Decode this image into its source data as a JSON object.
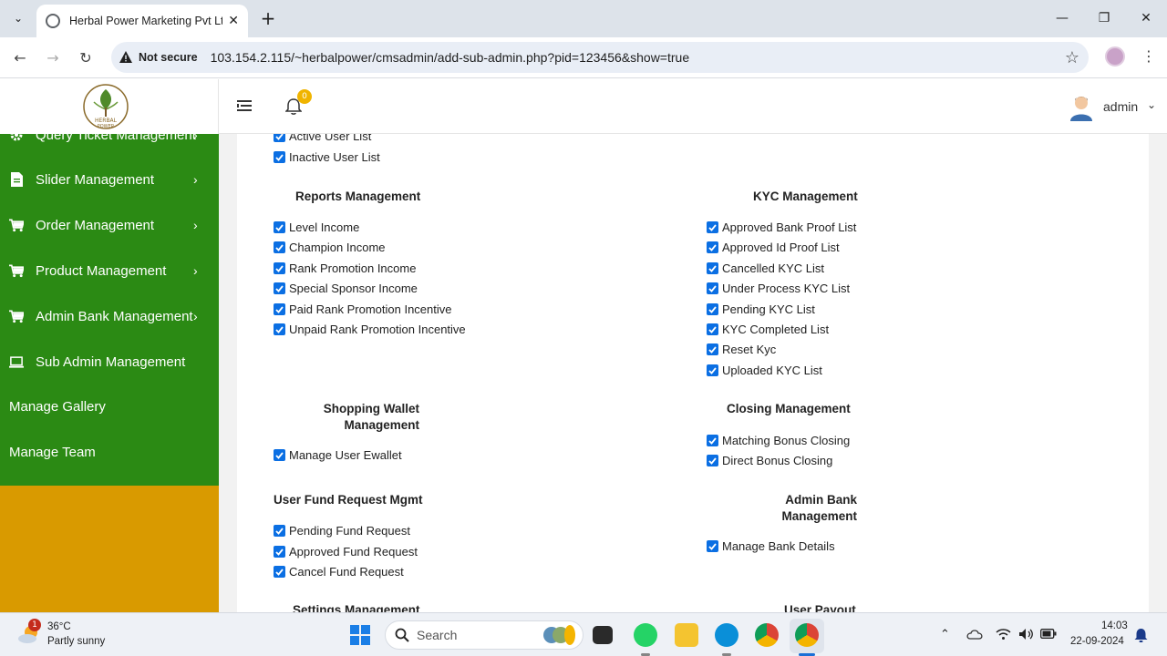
{
  "browser": {
    "tab_title": "Herbal Power Marketing Pvt Ltd",
    "security_label": "Not secure",
    "url": "103.154.2.115/~herbalpower/cmsadmin/add-sub-admin.php?pid=123456&show=true"
  },
  "header": {
    "logo_text": "HERBAL POWER",
    "notification_count": "0",
    "user_name": "admin"
  },
  "sidebar": {
    "items": [
      {
        "label": "Query Ticket Management",
        "icon": "gear-icon"
      },
      {
        "label": "Slider Management",
        "icon": "document-icon"
      },
      {
        "label": "Order Management",
        "icon": "cart-icon"
      },
      {
        "label": "Product Management",
        "icon": "cart-icon"
      },
      {
        "label": "Admin Bank Management",
        "icon": "cart-icon"
      },
      {
        "label": "Sub Admin Management",
        "icon": "laptop-icon"
      },
      {
        "label": "Manage Gallery"
      },
      {
        "label": "Manage Team"
      }
    ],
    "colors": {
      "background": "#2b8a14",
      "fill": "#d99a00"
    }
  },
  "permissions": {
    "user_partial": [
      "Active User List",
      "Inactive User List"
    ],
    "reports": {
      "title": "Reports Management",
      "items": [
        "Level Income",
        "Champion Income",
        "Rank Promotion Income",
        "Special Sponsor Income",
        "Paid Rank Promotion Incentive",
        "Unpaid Rank Promotion Incentive"
      ]
    },
    "kyc": {
      "title": "KYC Management",
      "items": [
        "Approved Bank Proof List",
        "Approved Id Proof List",
        "Cancelled KYC List",
        "Under Process KYC List",
        "Pending KYC List",
        "KYC Completed List",
        "Reset Kyc",
        "Uploaded KYC List"
      ]
    },
    "shopping_wallet": {
      "title_line1": "Shopping Wallet",
      "title_line2": "Management",
      "items": [
        "Manage User Ewallet"
      ]
    },
    "closing": {
      "title": "Closing Management",
      "items": [
        "Matching Bonus Closing",
        "Direct Bonus Closing"
      ]
    },
    "fund_request": {
      "title": "User Fund Request Mgmt",
      "items": [
        "Pending Fund Request",
        "Approved Fund Request",
        "Cancel Fund Request"
      ]
    },
    "admin_bank": {
      "title_line1": "Admin Bank",
      "title_line2": "Management",
      "items": [
        "Manage Bank Details"
      ]
    },
    "settings": {
      "title": "Settings Management"
    },
    "payout": {
      "title": "User Payout"
    }
  },
  "taskbar": {
    "weather_badge": "1",
    "temperature": "36°C",
    "condition": "Partly sunny",
    "search_label": "Search",
    "time": "14:03",
    "date": "22-09-2024"
  },
  "colors": {
    "checkbox": "#0b6fe3",
    "accent_badge": "#f0b400"
  }
}
